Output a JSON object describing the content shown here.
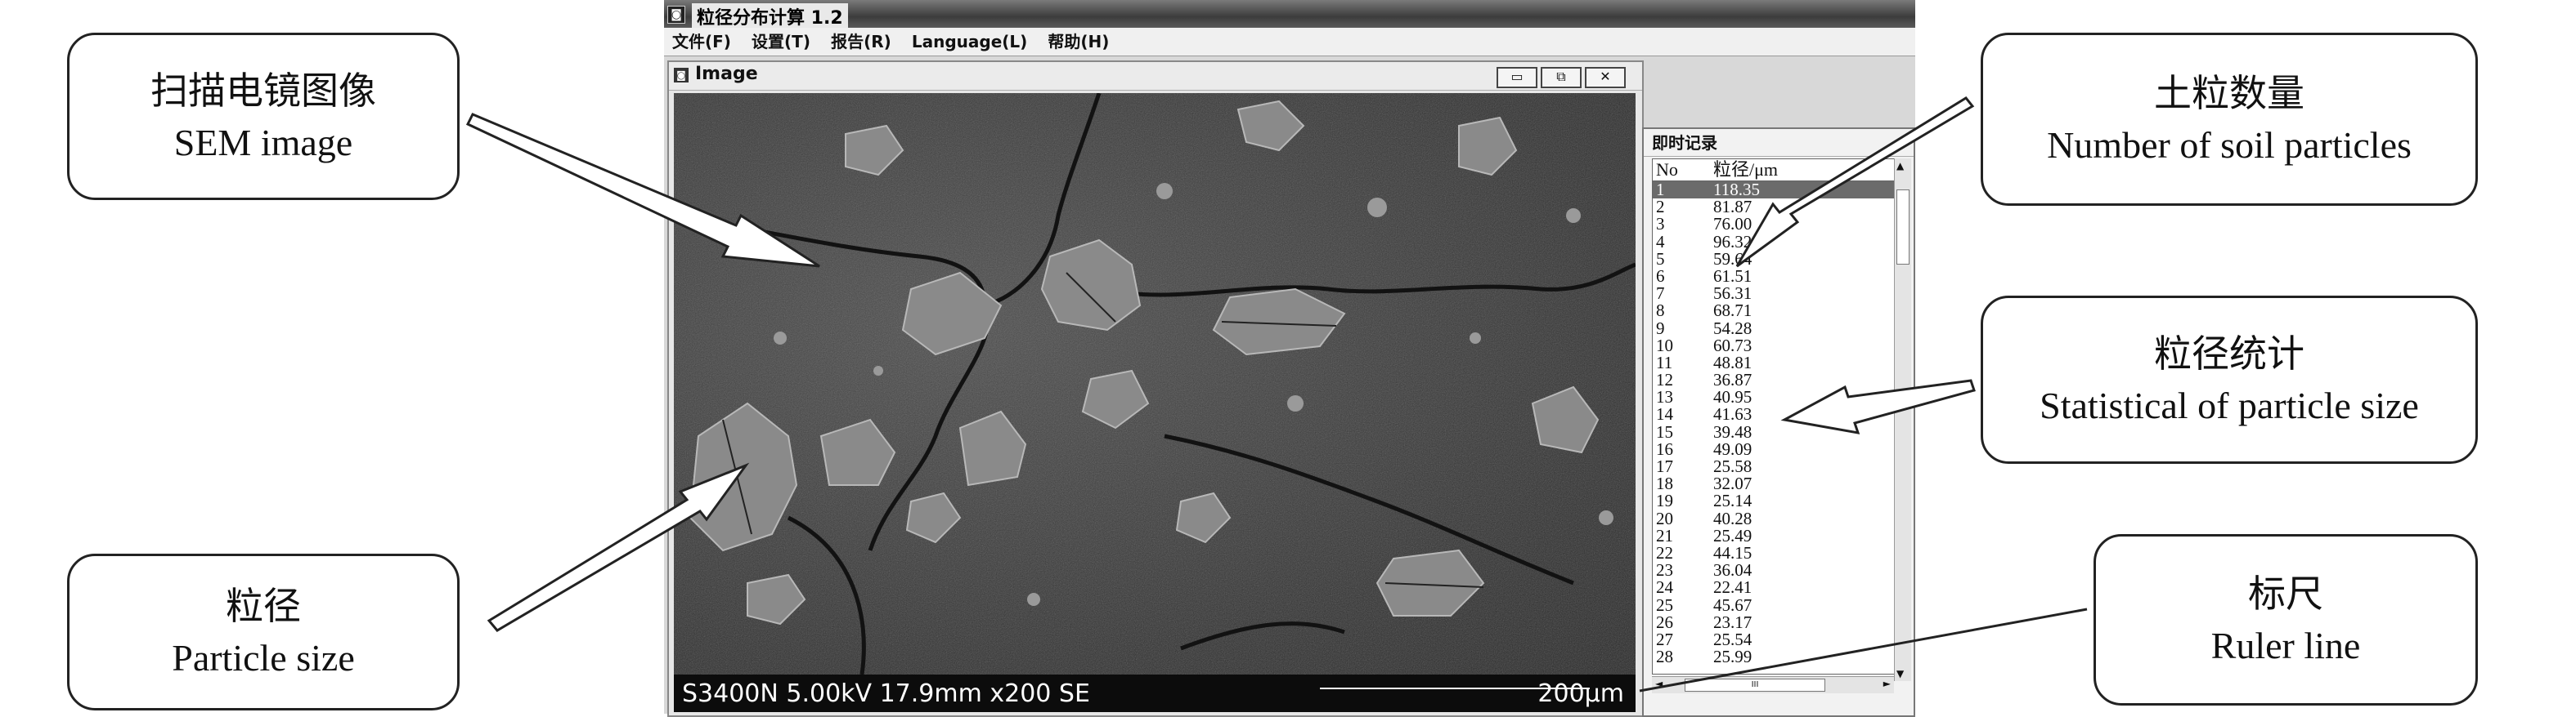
{
  "app": {
    "title": "粒径分布计算 1.2",
    "title_icon": "app-icon",
    "menu": [
      "文件(F)",
      "设置(T)",
      "报告(R)",
      "Language(L)",
      "帮助(H)"
    ]
  },
  "image_window": {
    "title": "Image",
    "buttons": {
      "minimize": "▭",
      "restore": "⧉",
      "close": "✕"
    },
    "info_text": "S3400N 5.00kV 17.9mm x200 SE",
    "scale_text": "200μm"
  },
  "record_panel": {
    "title": "即时记录",
    "columns": [
      "No",
      "粒径/μm"
    ],
    "rows": [
      [
        "1",
        "118.35"
      ],
      [
        "2",
        "81.87"
      ],
      [
        "3",
        "76.00"
      ],
      [
        "4",
        "96.32"
      ],
      [
        "5",
        "59.64"
      ],
      [
        "6",
        "61.51"
      ],
      [
        "7",
        "56.31"
      ],
      [
        "8",
        "68.71"
      ],
      [
        "9",
        "54.28"
      ],
      [
        "10",
        "60.73"
      ],
      [
        "11",
        "48.81"
      ],
      [
        "12",
        "36.87"
      ],
      [
        "13",
        "40.95"
      ],
      [
        "14",
        "41.63"
      ],
      [
        "15",
        "39.48"
      ],
      [
        "16",
        "49.09"
      ],
      [
        "17",
        "25.58"
      ],
      [
        "18",
        "32.07"
      ],
      [
        "19",
        "25.14"
      ],
      [
        "20",
        "40.28"
      ],
      [
        "21",
        "25.49"
      ],
      [
        "22",
        "44.15"
      ],
      [
        "23",
        "36.04"
      ],
      [
        "24",
        "22.41"
      ],
      [
        "25",
        "45.67"
      ],
      [
        "26",
        "23.17"
      ],
      [
        "27",
        "25.54"
      ],
      [
        "28",
        "25.99"
      ]
    ],
    "selected_row": 0,
    "hscroll_thumb": "III"
  },
  "callouts": {
    "sem": {
      "cn": "扫描电镜图像",
      "en": "SEM image"
    },
    "particle_size": {
      "cn": "粒径",
      "en": "Particle size"
    },
    "count": {
      "cn": "土粒数量",
      "en": "Number of soil particles"
    },
    "statistics": {
      "cn": "粒径统计",
      "en": "Statistical of particle size"
    },
    "ruler": {
      "cn": "标尺",
      "en": "Ruler line"
    }
  }
}
